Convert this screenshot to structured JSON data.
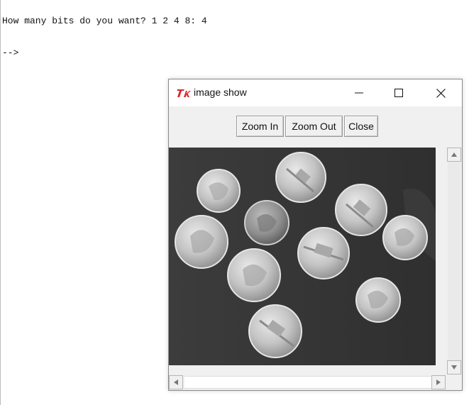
{
  "console": {
    "prompt_line": "How many bits do you want? 1 2 4 8: 4",
    "cursor_line": "-->"
  },
  "window": {
    "title": "image show",
    "app_icon": "tk-feather-logo",
    "controls": {
      "minimize_icon": "minimize-icon",
      "maximize_icon": "maximize-icon",
      "close_icon": "close-icon"
    }
  },
  "toolbar": {
    "zoom_in_label": "Zoom In",
    "zoom_out_label": "Zoom Out",
    "close_label": "Close"
  },
  "canvas": {
    "content": "grayscale-coins-image",
    "background_color": "#3a3a3a",
    "coin_color": "#c9c9c9"
  },
  "scrollbars": {
    "vertical": {
      "up_icon": "arrow-up-icon",
      "down_icon": "arrow-down-icon"
    },
    "horizontal": {
      "left_icon": "arrow-left-icon",
      "right_icon": "arrow-right-icon"
    }
  },
  "colors": {
    "window_bg": "#f0f0f0",
    "titlebar_bg": "#ffffff",
    "logo_red": "#d8262e"
  }
}
